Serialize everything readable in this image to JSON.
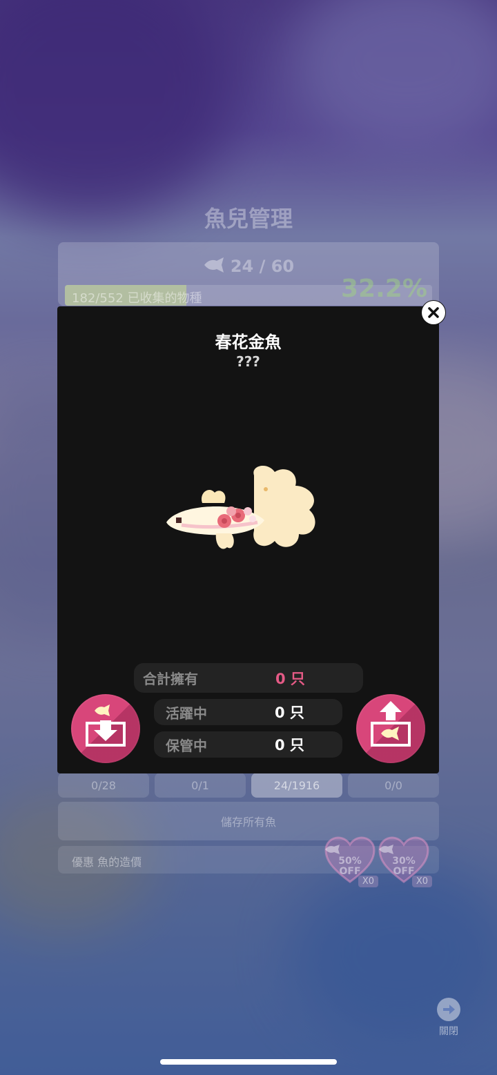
{
  "background": {
    "title": "魚兒管理",
    "fish_capacity": "24 / 60",
    "collection_text": "182/552 已收集的物種",
    "collection_percent": "32.2%",
    "collection_progress": 0.33,
    "tabs": [
      "0/28",
      "0/1",
      "24/1916",
      "0/0"
    ],
    "save_all_label": "儲存所有魚",
    "discount_label": "優惠 魚的造價",
    "coupons": [
      {
        "percent": "50%",
        "off": "OFF",
        "count": "X0"
      },
      {
        "percent": "30%",
        "off": "OFF",
        "count": "X0"
      }
    ],
    "close_label": "關閉"
  },
  "modal": {
    "fish_name": "春花金魚",
    "fish_subtitle": "???",
    "stats": {
      "total_label": "合計擁有",
      "total_value": "0 只",
      "active_label": "活躍中",
      "active_value": "0 只",
      "stored_label": "保管中",
      "stored_value": "0 只"
    }
  },
  "colors": {
    "accent_pink": "#d8467a",
    "value_pink": "#e55a86",
    "modal_bg": "#131313"
  }
}
